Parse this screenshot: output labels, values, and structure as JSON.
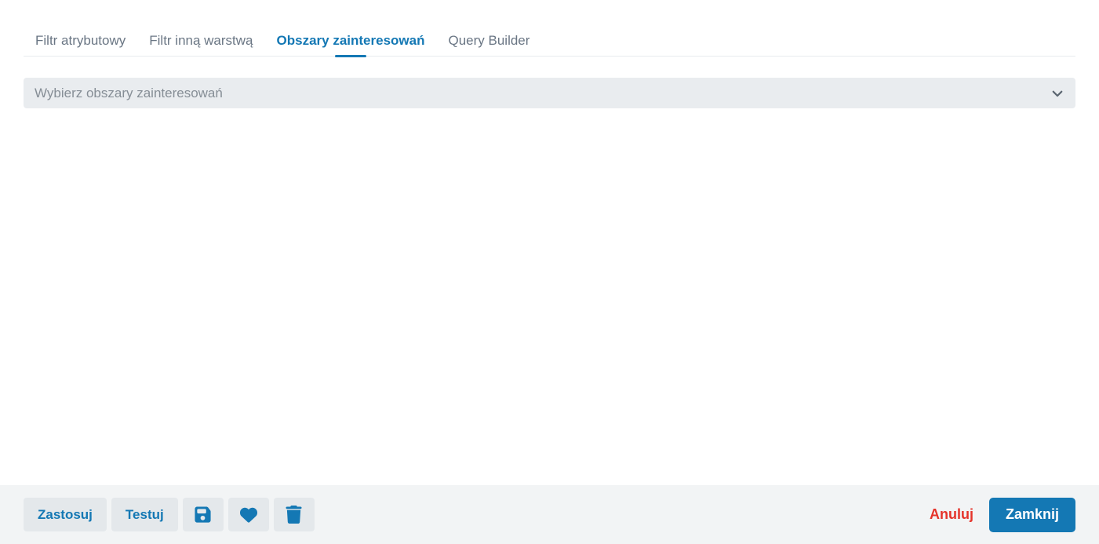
{
  "colors": {
    "accent_blue": "#1478b4",
    "danger_red": "#e5342b",
    "inactive_tab_gray": "#6a7684",
    "control_bg": "#e9ecef",
    "placeholder_gray": "#868e96",
    "footer_bg": "#f2f4f5",
    "button_bg": "#e4e8eb"
  },
  "tabs": {
    "items": [
      {
        "label": "Filtr atrybutowy",
        "active": false
      },
      {
        "label": "Filtr inną warstwą",
        "active": false
      },
      {
        "label": "Obszary zainteresowań",
        "active": true
      },
      {
        "label": "Query Builder",
        "active": false
      }
    ]
  },
  "content": {
    "area_select": {
      "placeholder": "Wybierz obszary zainteresowań",
      "icon": "chevron-down-icon"
    }
  },
  "footer": {
    "apply_label": "Zastosuj",
    "test_label": "Testuj",
    "save_icon": "save-icon",
    "favorite_icon": "heart-icon",
    "delete_icon": "trash-icon",
    "cancel_label": "Anuluj",
    "close_label": "Zamknij"
  }
}
